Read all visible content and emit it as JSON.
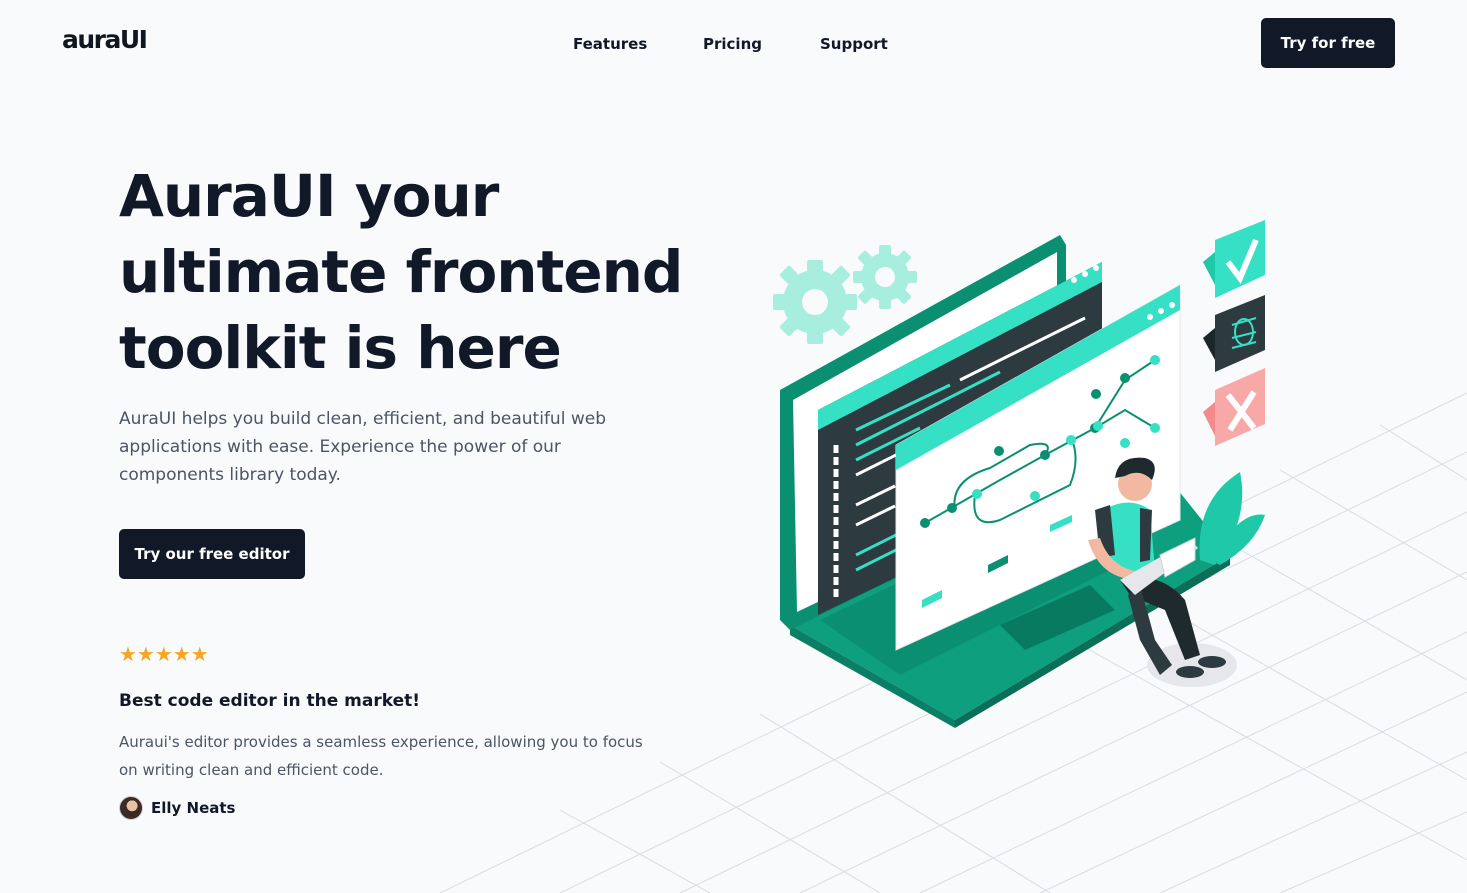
{
  "brand": {
    "logo_text": "auraUI"
  },
  "nav": {
    "items": [
      {
        "label": "Features"
      },
      {
        "label": "Pricing"
      },
      {
        "label": "Support"
      }
    ],
    "cta_label": "Try for free"
  },
  "hero": {
    "title_line_1": "AuraUI your",
    "title_line_2": "ultimate frontend",
    "title_line_3": "toolkit is here",
    "description": "AuraUI helps you build clean, efficient, and beautiful web applications with ease. Experience the power of our components library today.",
    "cta_label": "Try our free editor"
  },
  "testimonial": {
    "rating": 5,
    "rating_max": 5,
    "stars": "★★★★★",
    "title": "Best code editor in the market!",
    "text": "Auraui's editor provides a seamless experience, allowing you to focus on writing clean and efficient code.",
    "author": "Elly Neats"
  },
  "colors": {
    "primary_dark": "#111827",
    "accent_teal": "#0e9f7e",
    "accent_light": "#35e0c4",
    "star": "#f5a623",
    "error_pink": "#f9a8a8"
  },
  "icons": [
    "gear-icon",
    "check-icon",
    "bug-icon",
    "close-icon",
    "star-icon",
    "plant-icon"
  ]
}
